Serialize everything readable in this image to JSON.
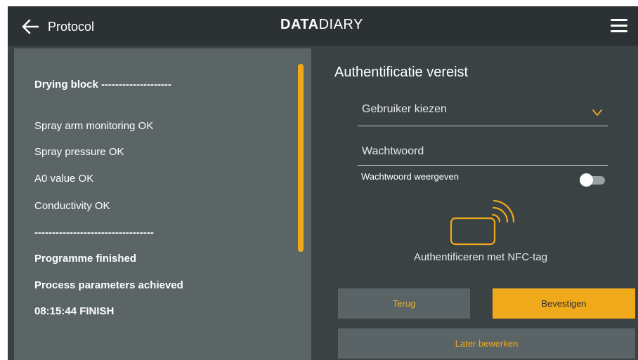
{
  "header": {
    "title": "Protocol",
    "logo_bold": "DATA",
    "logo_light": "DIARY",
    "back_icon": "arrow-left-icon",
    "menu_icon": "hamburger-menu-icon"
  },
  "protocol": {
    "lines": [
      {
        "text": "Drying block --------------------",
        "bold": true
      },
      {
        "text": "Spray arm monitoring OK",
        "bold": false
      },
      {
        "text": "Spray pressure OK",
        "bold": false
      },
      {
        "text": "A0 value OK",
        "bold": false
      },
      {
        "text": "Conductivity OK",
        "bold": false
      },
      {
        "text": "----------------------------------",
        "bold": true
      },
      {
        "text": "Programme finished",
        "bold": true
      },
      {
        "text": "Process parameters achieved",
        "bold": true
      },
      {
        "text": "08:15:44 FINISH",
        "bold": true
      }
    ]
  },
  "auth": {
    "title": "Authentificatie vereist",
    "user_select_placeholder": "Gebruiker kiezen",
    "password_placeholder": "Wachtwoord",
    "password_value": "",
    "show_password_label": "Wachtwoord weergeven",
    "show_password_enabled": false,
    "nfc_icon": "nfc-card-icon",
    "nfc_label": "Authentificeren met NFC-tag"
  },
  "buttons": {
    "back": "Terug",
    "confirm": "Bevestigen",
    "later": "Later bewerken"
  },
  "colors": {
    "accent": "#f1a91c",
    "header_bg": "#2c3234",
    "app_bg": "#3b4244",
    "panel_bg": "#5b6566"
  }
}
